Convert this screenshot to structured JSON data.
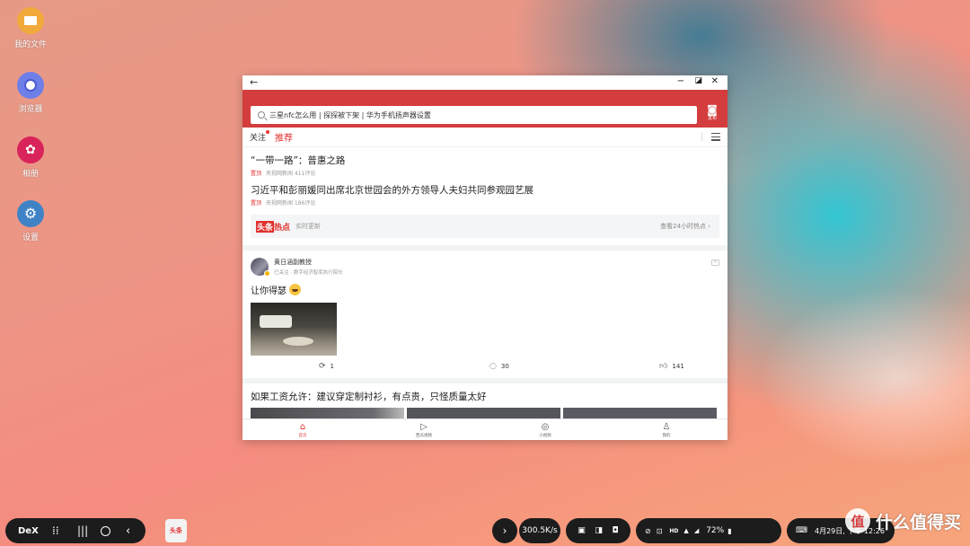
{
  "desktop": {
    "icons": [
      {
        "label": "我的文件",
        "icon": "folder-icon",
        "color": "#f2a93b"
      },
      {
        "label": "浏览器",
        "icon": "browser-planet-icon",
        "color": "#6f7fe8"
      },
      {
        "label": "相册",
        "icon": "flower-gallery-icon",
        "color": "#d8245a"
      },
      {
        "label": "设置",
        "icon": "gear-icon",
        "color": "#3f83c6"
      }
    ]
  },
  "window": {
    "search_text": "三星nfc怎么用 | 探探被下架 | 华为手机扬声器设置",
    "publish_label": "发布",
    "accent": "#d43d3d",
    "tabs": {
      "follow": "关注",
      "recommend": "推荐"
    },
    "news": [
      {
        "title": "“一带一路”：普惠之路",
        "tag": "置顶",
        "source": "央视网新闻",
        "comments": "411评论"
      },
      {
        "title": "习近平和彭丽媛同出席北京世园会的外方领导人夫妇共同参观园艺展",
        "tag": "置顶",
        "source": "央视网新闻",
        "comments": "186评论"
      }
    ],
    "hot": {
      "logo_a": "头条",
      "logo_b": "热点",
      "subtitle": "实时更新",
      "link": "查看24小时热点 ›"
    },
    "post": {
      "author": "黄日涵副教授",
      "subtitle": "已关注 · 数字经济智库执行院长",
      "text": "让你得瑟",
      "repost_count": "1",
      "comment_count": "30",
      "like_count": "141"
    },
    "article": {
      "title": "如果工资允许：建议穿定制衬衫，有点贵，只怪质量太好"
    },
    "bottom_nav": [
      {
        "label": "首页",
        "icon": "home-icon"
      },
      {
        "label": "西瓜视频",
        "icon": "play-icon"
      },
      {
        "label": "小视频",
        "icon": "short-video-icon"
      },
      {
        "label": "我的",
        "icon": "profile-icon"
      }
    ]
  },
  "taskbar": {
    "dex_label": "DeX",
    "app_label": "头条",
    "network_speed": "300.5K/s",
    "battery": "72%",
    "date_time": "4月29日, 下午 12:26",
    "watermark": "什么值得买",
    "watermark_logo": "值"
  }
}
